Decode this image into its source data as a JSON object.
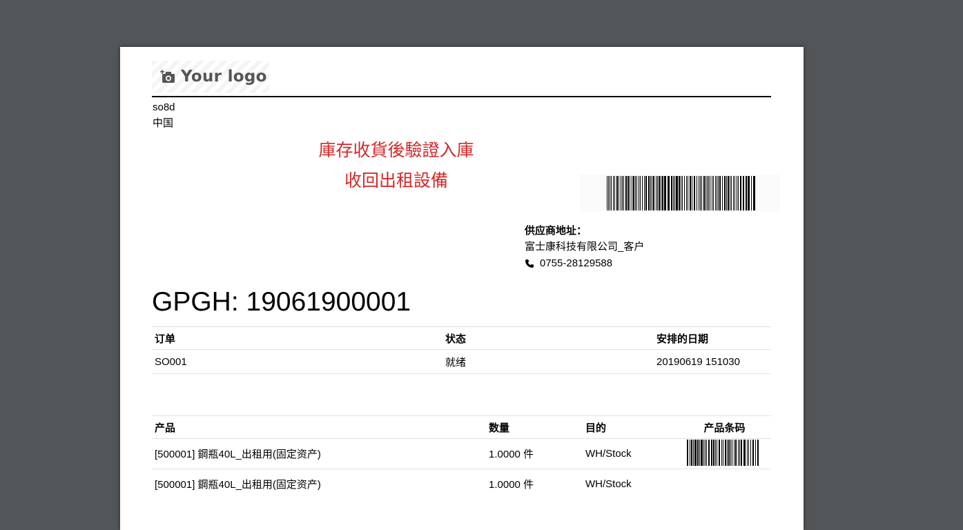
{
  "logo": {
    "text": "Your logo",
    "icon": "camera-plus-icon"
  },
  "company": {
    "name": "so8d",
    "country": "中国"
  },
  "note": {
    "line1": "庫存收貨後驗證入庫",
    "line2": "收回出租設備"
  },
  "vendor": {
    "label": "供应商地址：",
    "name": "富士康科技有限公司_客户",
    "phone": "0755-28129588",
    "phone_icon": "phone-icon"
  },
  "title": "GPGH: 19061900001",
  "order_table": {
    "headers": [
      "订单",
      "状态",
      "安排的日期"
    ],
    "row": [
      "SO001",
      "就绪",
      "20190619 151030"
    ]
  },
  "product_table": {
    "headers": [
      "产品",
      "数量",
      "目的",
      "产品条码"
    ],
    "rows": [
      [
        "[500001] 鋼瓶40L_出租用(固定资产)",
        "1.0000 件",
        "WH/Stock"
      ],
      [
        "[500001] 鋼瓶40L_出租用(固定资产)",
        "1.0000 件",
        "WH/Stock"
      ]
    ]
  },
  "colors": {
    "background": "#525659",
    "note": "#d62828"
  }
}
